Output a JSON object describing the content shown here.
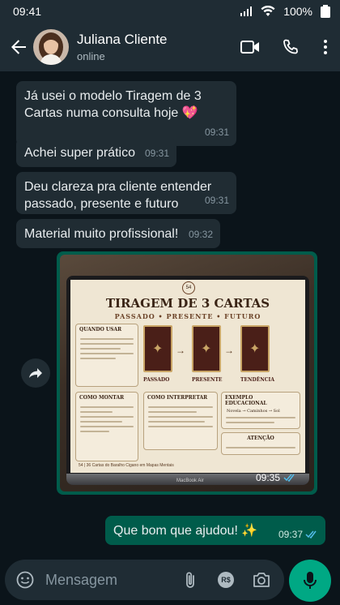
{
  "status_bar": {
    "time": "09:41",
    "battery": "100%"
  },
  "header": {
    "name": "Juliana Cliente",
    "status": "online"
  },
  "messages": [
    {
      "text": "Já usei o modelo Tiragem de 3 Cartas numa consulta hoje 💖",
      "time": "09:31"
    },
    {
      "text": "Achei super prático",
      "time": "09:31"
    },
    {
      "text": "Deu clareza pra cliente entender passado, presente e futuro",
      "time": "09:31"
    },
    {
      "text": "Material muito profissional!",
      "time": "09:32"
    }
  ],
  "image_message": {
    "time": "09:35",
    "document": {
      "title": "TIRAGEM DE 3 CARTAS",
      "subtitle": "PASSADO • PRESENTE • FUTURO",
      "badge": "54",
      "card_labels": [
        "PASSADO",
        "PRESENTE",
        "TENDÊNCIA"
      ],
      "sections": [
        "QUANDO USAR",
        "COMO INTERPRETAR",
        "EXEMPLO EDUCACIONAL",
        "COMO MONTAR",
        "ATENÇÃO"
      ],
      "example_flow": "Novela → Caminhos → Sol",
      "footer": "54 | 36 Cartas do Baralho Cigano em Mapas Mentais",
      "laptop_brand": "MacBook Air"
    }
  },
  "outgoing": {
    "text": "Que bom que ajudou! ✨",
    "time": "09:37"
  },
  "input": {
    "placeholder": "Mensagem",
    "rs_label": "R$"
  },
  "colors": {
    "bubble_in": "#202c33",
    "bubble_out": "#005c4b",
    "accent": "#00a884",
    "background": "#0b141a"
  }
}
